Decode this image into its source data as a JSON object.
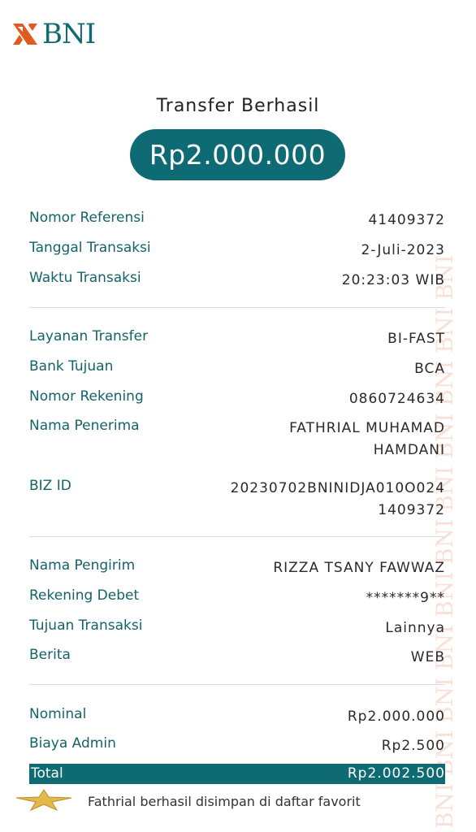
{
  "brand": {
    "name": "BNI",
    "logo_color": "#0f6b73",
    "accent": "#e15a22"
  },
  "watermark_text": "BNI BNI BNI BNI BNI BNI BNI BNI BNI BNI BNI",
  "title": "Transfer Berhasil",
  "amount": "Rp2.000.000",
  "sections": {
    "reference": [
      {
        "label": "Nomor Referensi",
        "value": "41409372"
      },
      {
        "label": "Tanggal Transaksi",
        "value": "2-Juli-2023"
      },
      {
        "label": "Waktu Transaksi",
        "value": "20:23:03 WIB"
      }
    ],
    "transfer": [
      {
        "label": "Layanan Transfer",
        "value": "BI-FAST"
      },
      {
        "label": "Bank Tujuan",
        "value": "BCA"
      },
      {
        "label": "Nomor Rekening",
        "value": "0860724634"
      },
      {
        "label": "Nama Penerima",
        "value_line1": "FATHRIAL MUHAMAD",
        "value_line2": "HAMDANI"
      },
      {
        "label": "BIZ ID",
        "value_line1": "20230702BNINIDJA010O024",
        "value_line2": "1409372"
      }
    ],
    "sender": [
      {
        "label": "Nama Pengirim",
        "value": "RIZZA TSANY FAWWAZ"
      },
      {
        "label": "Rekening Debet",
        "value": "*******9**"
      },
      {
        "label": "Tujuan Transaksi",
        "value": "Lainnya"
      },
      {
        "label": "Berita",
        "value": "WEB"
      }
    ],
    "fees": [
      {
        "label": "Nominal",
        "value": "Rp2.000.000"
      },
      {
        "label": "Biaya Admin",
        "value": "Rp2.500"
      }
    ]
  },
  "total": {
    "label": "Total",
    "value": "Rp2.002.500"
  },
  "favorite": {
    "icon": "star-icon",
    "text": "Fathrial berhasil disimpan di daftar favorit"
  }
}
